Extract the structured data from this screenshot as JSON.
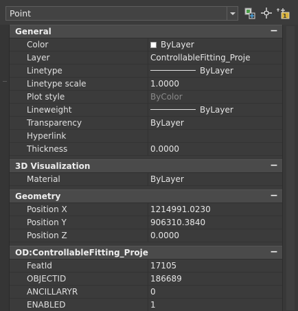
{
  "toolbar": {
    "selection": "Point",
    "buttons": [
      {
        "name": "quick-select-button",
        "icon": "quick-select-icon"
      },
      {
        "name": "select-objects-button",
        "icon": "select-objects-icon"
      },
      {
        "name": "toggle-pickadd-button",
        "icon": "pickadd-toggle-icon"
      }
    ]
  },
  "colors": {
    "panel_bg": "#3b3b3b",
    "header_bg": "#4a4a4a",
    "text": "#e0e0e0",
    "dim_text": "#8a8a8a"
  },
  "sections": [
    {
      "title": "General",
      "collapse": "−",
      "rows": [
        {
          "label": "Color",
          "value": "ByLayer",
          "type": "color"
        },
        {
          "label": "Layer",
          "value": "ControllableFitting_Proje"
        },
        {
          "label": "Linetype",
          "value": "ByLayer",
          "type": "linetype"
        },
        {
          "label": "Linetype scale",
          "value": "1.0000"
        },
        {
          "label": "Plot style",
          "value": "ByColor",
          "dim": true
        },
        {
          "label": "Lineweight",
          "value": "ByLayer",
          "type": "linetype"
        },
        {
          "label": "Transparency",
          "value": "ByLayer"
        },
        {
          "label": "Hyperlink",
          "value": ""
        },
        {
          "label": "Thickness",
          "value": "0.0000"
        }
      ]
    },
    {
      "title": "3D Visualization",
      "collapse": "−",
      "rows": [
        {
          "label": "Material",
          "value": "ByLayer"
        }
      ]
    },
    {
      "title": "Geometry",
      "collapse": "−",
      "rows": [
        {
          "label": "Position X",
          "value": "1214991.0230"
        },
        {
          "label": "Position Y",
          "value": "906310.3840"
        },
        {
          "label": "Position Z",
          "value": "0.0000"
        }
      ]
    },
    {
      "title": "OD:ControllableFitting_Proje",
      "collapse": "−",
      "rows": [
        {
          "label": "FeatId",
          "value": "17105"
        },
        {
          "label": "OBJECTID",
          "value": "186689"
        },
        {
          "label": "ANCILLARYR",
          "value": "0"
        },
        {
          "label": "ENABLED",
          "value": "1"
        },
        {
          "label": "",
          "value": ""
        }
      ]
    }
  ]
}
